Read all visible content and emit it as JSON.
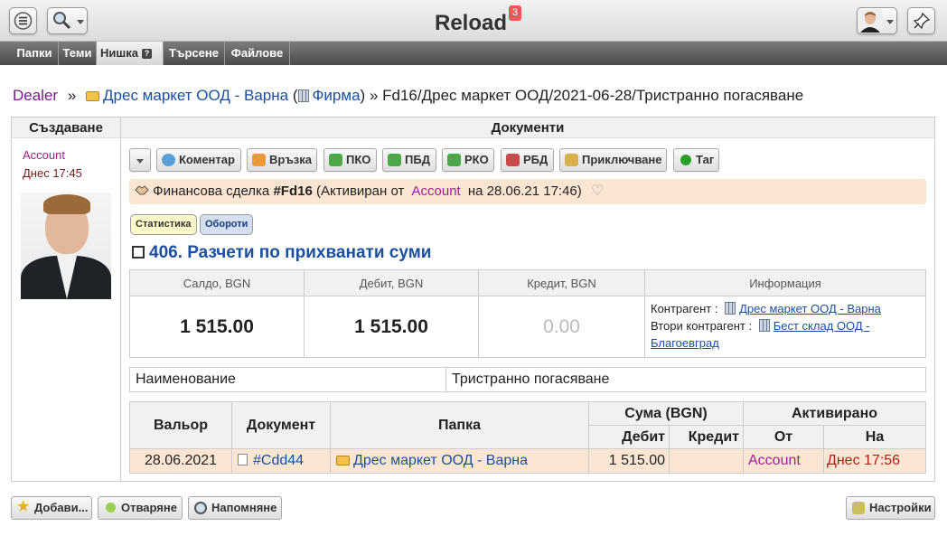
{
  "app": {
    "title": "Reload",
    "notifications": "3"
  },
  "nav_tabs": [
    {
      "label": "Папки"
    },
    {
      "label": "Теми"
    },
    {
      "label": "Нишка",
      "active": true,
      "help": "?"
    },
    {
      "label": "Търсене"
    },
    {
      "label": "Файлове"
    }
  ],
  "breadcrumb": {
    "root": "Dealer",
    "sep1": "»",
    "folder": "Дрес маркет ООД - Варна",
    "paren_open": "(",
    "company": "Фирма",
    "paren_close": ")",
    "sep2": "»",
    "current": "Fd16/Дрес маркет ООД/2021-06-28/Тристранно погасяване"
  },
  "columns": {
    "create": "Създаване",
    "documents": "Документи"
  },
  "author": {
    "name": "Account",
    "time": "Днес 17:45"
  },
  "toolbar": [
    {
      "label": "Коментар",
      "icon": "comment-icon",
      "color": "#5aa0d8"
    },
    {
      "label": "Връзка",
      "icon": "link-icon",
      "color": "#e89a3a"
    },
    {
      "label": "ПКО",
      "icon": "cash-in-icon",
      "color": "#4aa84a"
    },
    {
      "label": "ПБД",
      "icon": "bank-in-icon",
      "color": "#4aa84a"
    },
    {
      "label": "РКО",
      "icon": "cash-out-icon",
      "color": "#4aa84a"
    },
    {
      "label": "РБД",
      "icon": "bank-out-icon",
      "color": "#c84a4a"
    },
    {
      "label": "Приключване",
      "icon": "lock-icon",
      "color": "#d8b04a"
    },
    {
      "label": "Таг",
      "icon": "tag-icon",
      "color": "#2aa02a"
    }
  ],
  "deal": {
    "prefix": "Финансова сделка",
    "id": "#Fd16",
    "status_open": "(Активиран от",
    "by": "Account",
    "status_close": "на 28.06.21 17:46)"
  },
  "chips": {
    "stats": "Статистика",
    "turnover": "Обороти"
  },
  "account": {
    "title": "406. Разчети по прихванати суми"
  },
  "balance": {
    "headers": [
      "Салдо, BGN",
      "Дебит, BGN",
      "Кредит, BGN",
      "Информация"
    ],
    "saldo": "1 515.00",
    "debit": "1 515.00",
    "credit": "0.00",
    "contractor_label": "Контрагент :",
    "contractor": "Дрес маркет ООД - Варна",
    "contractor2_label": "Втори контрагент :",
    "contractor2": "Бест склад ООД - Благоевград"
  },
  "name_row": {
    "label": "Наименование",
    "value": "Тристранно погасяване"
  },
  "docs": {
    "headers": {
      "valor": "Вальор",
      "document": "Документ",
      "folder": "Папка",
      "amount": "Сума (BGN)",
      "activated": "Активирано",
      "debit": "Дебит",
      "credit": "Кредит",
      "from": "От",
      "on": "На"
    },
    "rows": [
      {
        "valor": "28.06.2021",
        "document": "#Cdd44",
        "folder": "Дрес маркет ООД - Варна",
        "debit": "1 515.00",
        "credit": "",
        "from": "Account",
        "on": "Днес 17:56"
      }
    ]
  },
  "footer": {
    "add": "Добави...",
    "open": "Отваряне",
    "remind": "Напомняне",
    "settings": "Настройки"
  }
}
